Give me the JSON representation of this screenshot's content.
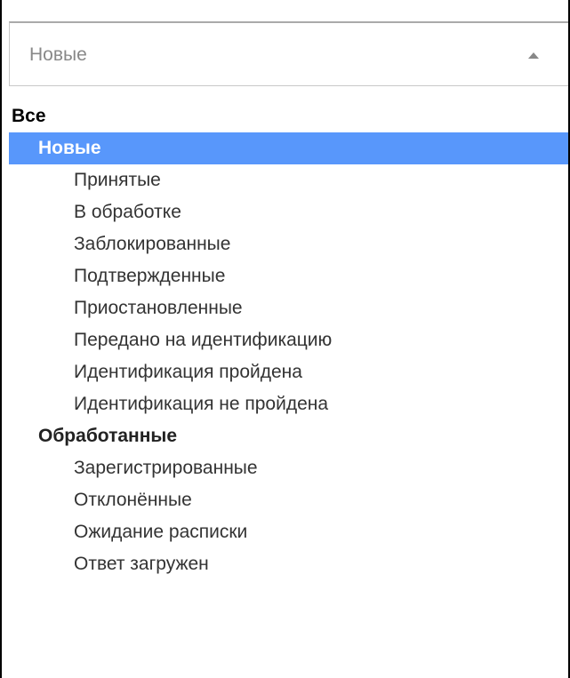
{
  "select": {
    "value": "Новые",
    "arrow_icon": "triangle-up-icon"
  },
  "options": [
    {
      "label": "Все",
      "level": 0,
      "highlighted": false
    },
    {
      "label": "Новые",
      "level": 1,
      "highlighted": true
    },
    {
      "label": "Принятые",
      "level": 2,
      "highlighted": false
    },
    {
      "label": "В обработке",
      "level": 2,
      "highlighted": false
    },
    {
      "label": "Заблокированные",
      "level": 2,
      "highlighted": false
    },
    {
      "label": "Подтвержденные",
      "level": 2,
      "highlighted": false
    },
    {
      "label": "Приостановленные",
      "level": 2,
      "highlighted": false
    },
    {
      "label": "Передано на идентификацию",
      "level": 2,
      "highlighted": false
    },
    {
      "label": "Идентификация пройдена",
      "level": 2,
      "highlighted": false
    },
    {
      "label": "Идентификация не пройдена",
      "level": 2,
      "highlighted": false
    },
    {
      "label": "Обработанные",
      "level": 1,
      "highlighted": false
    },
    {
      "label": "Зарегистрированные",
      "level": 2,
      "highlighted": false
    },
    {
      "label": "Отклонённые",
      "level": 2,
      "highlighted": false
    },
    {
      "label": "Ожидание расписки",
      "level": 2,
      "highlighted": false
    },
    {
      "label": "Ответ загружен",
      "level": 2,
      "highlighted": false
    }
  ],
  "colors": {
    "highlight": "#5897fb",
    "placeholder_text": "#888888"
  }
}
